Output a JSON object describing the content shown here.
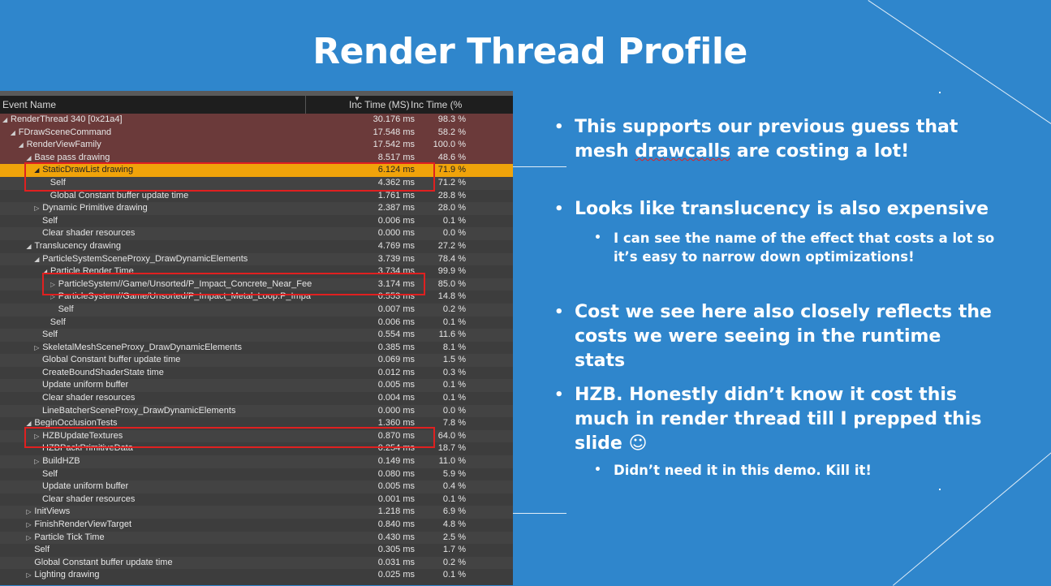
{
  "slide": {
    "title": "Render Thread Profile"
  },
  "profiler": {
    "columns": [
      "Event Name",
      "Inc Time (MS)",
      "Inc Time (%"
    ],
    "rows": [
      {
        "name": "RenderThread 340 [0x21a4]",
        "ms": "30.176 ms",
        "pct": "98.3 %",
        "indent": 0,
        "tri": "◢",
        "style": "hot"
      },
      {
        "name": "FDrawSceneCommand",
        "ms": "17.548 ms",
        "pct": "58.2 %",
        "indent": 1,
        "tri": "◢",
        "style": "hot"
      },
      {
        "name": "RenderViewFamily",
        "ms": "17.542 ms",
        "pct": "100.0 %",
        "indent": 2,
        "tri": "◢",
        "style": "hot"
      },
      {
        "name": "Base pass drawing",
        "ms": "8.517 ms",
        "pct": "48.6 %",
        "indent": 3,
        "tri": "◢",
        "style": "hot"
      },
      {
        "name": "StaticDrawList drawing",
        "ms": "6.124 ms",
        "pct": "71.9 %",
        "indent": 4,
        "tri": "◢",
        "style": "sel"
      },
      {
        "name": "Self",
        "ms": "4.362 ms",
        "pct": "71.2 %",
        "indent": 6,
        "tri": "",
        "style": "alt"
      },
      {
        "name": "Global Constant buffer update time",
        "ms": "1.761 ms",
        "pct": "28.8 %",
        "indent": 6,
        "tri": "",
        "style": ""
      },
      {
        "name": "Dynamic Primitive drawing",
        "ms": "2.387 ms",
        "pct": "28.0 %",
        "indent": 4,
        "tri": "▷",
        "style": "alt"
      },
      {
        "name": "Self",
        "ms": "0.006 ms",
        "pct": "0.1 %",
        "indent": 5,
        "tri": "",
        "style": ""
      },
      {
        "name": "Clear shader resources",
        "ms": "0.000 ms",
        "pct": "0.0 %",
        "indent": 5,
        "tri": "",
        "style": "alt"
      },
      {
        "name": "Translucency drawing",
        "ms": "4.769 ms",
        "pct": "27.2 %",
        "indent": 3,
        "tri": "◢",
        "style": ""
      },
      {
        "name": "ParticleSystemSceneProxy_DrawDynamicElements",
        "ms": "3.739 ms",
        "pct": "78.4 %",
        "indent": 4,
        "tri": "◢",
        "style": "alt"
      },
      {
        "name": "Particle Render Time",
        "ms": "3.734 ms",
        "pct": "99.9 %",
        "indent": 5,
        "tri": "◢",
        "style": ""
      },
      {
        "name": "ParticleSystem//Game/Unsorted/P_Impact_Concrete_Near_Fee",
        "ms": "3.174 ms",
        "pct": "85.0 %",
        "indent": 6,
        "tri": "▷",
        "style": "alt"
      },
      {
        "name": "ParticleSystem//Game/Unsorted/P_Impact_Metal_Loop.P_Impa",
        "ms": "0.553 ms",
        "pct": "14.8 %",
        "indent": 6,
        "tri": "▷",
        "style": ""
      },
      {
        "name": "Self",
        "ms": "0.007 ms",
        "pct": "0.2 %",
        "indent": 7,
        "tri": "",
        "style": "alt"
      },
      {
        "name": "Self",
        "ms": "0.006 ms",
        "pct": "0.1 %",
        "indent": 6,
        "tri": "",
        "style": ""
      },
      {
        "name": "Self",
        "ms": "0.554 ms",
        "pct": "11.6 %",
        "indent": 5,
        "tri": "",
        "style": "alt"
      },
      {
        "name": "SkeletalMeshSceneProxy_DrawDynamicElements",
        "ms": "0.385 ms",
        "pct": "8.1 %",
        "indent": 4,
        "tri": "▷",
        "style": ""
      },
      {
        "name": "Global Constant buffer update time",
        "ms": "0.069 ms",
        "pct": "1.5 %",
        "indent": 5,
        "tri": "",
        "style": "alt"
      },
      {
        "name": "CreateBoundShaderState time",
        "ms": "0.012 ms",
        "pct": "0.3 %",
        "indent": 5,
        "tri": "",
        "style": ""
      },
      {
        "name": "Update uniform buffer",
        "ms": "0.005 ms",
        "pct": "0.1 %",
        "indent": 5,
        "tri": "",
        "style": "alt"
      },
      {
        "name": "Clear shader resources",
        "ms": "0.004 ms",
        "pct": "0.1 %",
        "indent": 5,
        "tri": "",
        "style": ""
      },
      {
        "name": "LineBatcherSceneProxy_DrawDynamicElements",
        "ms": "0.000 ms",
        "pct": "0.0 %",
        "indent": 5,
        "tri": "",
        "style": "alt"
      },
      {
        "name": "BeginOcclusionTests",
        "ms": "1.360 ms",
        "pct": "7.8 %",
        "indent": 3,
        "tri": "◢",
        "style": ""
      },
      {
        "name": "HZBUpdateTextures",
        "ms": "0.870 ms",
        "pct": "64.0 %",
        "indent": 4,
        "tri": "▷",
        "style": "alt"
      },
      {
        "name": "HZBPackPrimitiveData",
        "ms": "0.254 ms",
        "pct": "18.7 %",
        "indent": 5,
        "tri": "",
        "style": ""
      },
      {
        "name": "BuildHZB",
        "ms": "0.149 ms",
        "pct": "11.0 %",
        "indent": 4,
        "tri": "▷",
        "style": "alt"
      },
      {
        "name": "Self",
        "ms": "0.080 ms",
        "pct": "5.9 %",
        "indent": 5,
        "tri": "",
        "style": ""
      },
      {
        "name": "Update uniform buffer",
        "ms": "0.005 ms",
        "pct": "0.4 %",
        "indent": 5,
        "tri": "",
        "style": "alt"
      },
      {
        "name": "Clear shader resources",
        "ms": "0.001 ms",
        "pct": "0.1 %",
        "indent": 5,
        "tri": "",
        "style": ""
      },
      {
        "name": "InitViews",
        "ms": "1.218 ms",
        "pct": "6.9 %",
        "indent": 3,
        "tri": "▷",
        "style": "alt"
      },
      {
        "name": "FinishRenderViewTarget",
        "ms": "0.840 ms",
        "pct": "4.8 %",
        "indent": 3,
        "tri": "▷",
        "style": ""
      },
      {
        "name": "Particle Tick Time",
        "ms": "0.430 ms",
        "pct": "2.5 %",
        "indent": 3,
        "tri": "▷",
        "style": "alt"
      },
      {
        "name": "Self",
        "ms": "0.305 ms",
        "pct": "1.7 %",
        "indent": 4,
        "tri": "",
        "style": ""
      },
      {
        "name": "Global Constant buffer update time",
        "ms": "0.031 ms",
        "pct": "0.2 %",
        "indent": 4,
        "tri": "",
        "style": "alt"
      },
      {
        "name": "Lighting drawing",
        "ms": "0.025 ms",
        "pct": "0.1 %",
        "indent": 3,
        "tri": "▷",
        "style": ""
      }
    ]
  },
  "bullets": [
    {
      "level": 1,
      "text": "This supports our previous guess that mesh ",
      "text_err": "drawcalls",
      "text_after": " are costing a lot!"
    },
    {
      "level": 1,
      "text": "Looks like translucency is also expensive"
    },
    {
      "level": 2,
      "text": "I can see the name of the effect that costs a lot so it’s easy to narrow down optimizations!"
    },
    {
      "level": 1,
      "text": "Cost we see here also closely reflects the costs we were seeing in the runtime stats"
    },
    {
      "level": 1,
      "text": "HZB. Honestly didn’t know it cost this much in render thread till I prepped this slide ☺"
    },
    {
      "level": 2,
      "text": "Didn’t need it in this demo. Kill it!"
    }
  ],
  "colors": {
    "background": "#2f86cc",
    "selected_row": "#f0a30a",
    "highlight_box": "#e02020",
    "hot_row": "#6b3a3a"
  }
}
